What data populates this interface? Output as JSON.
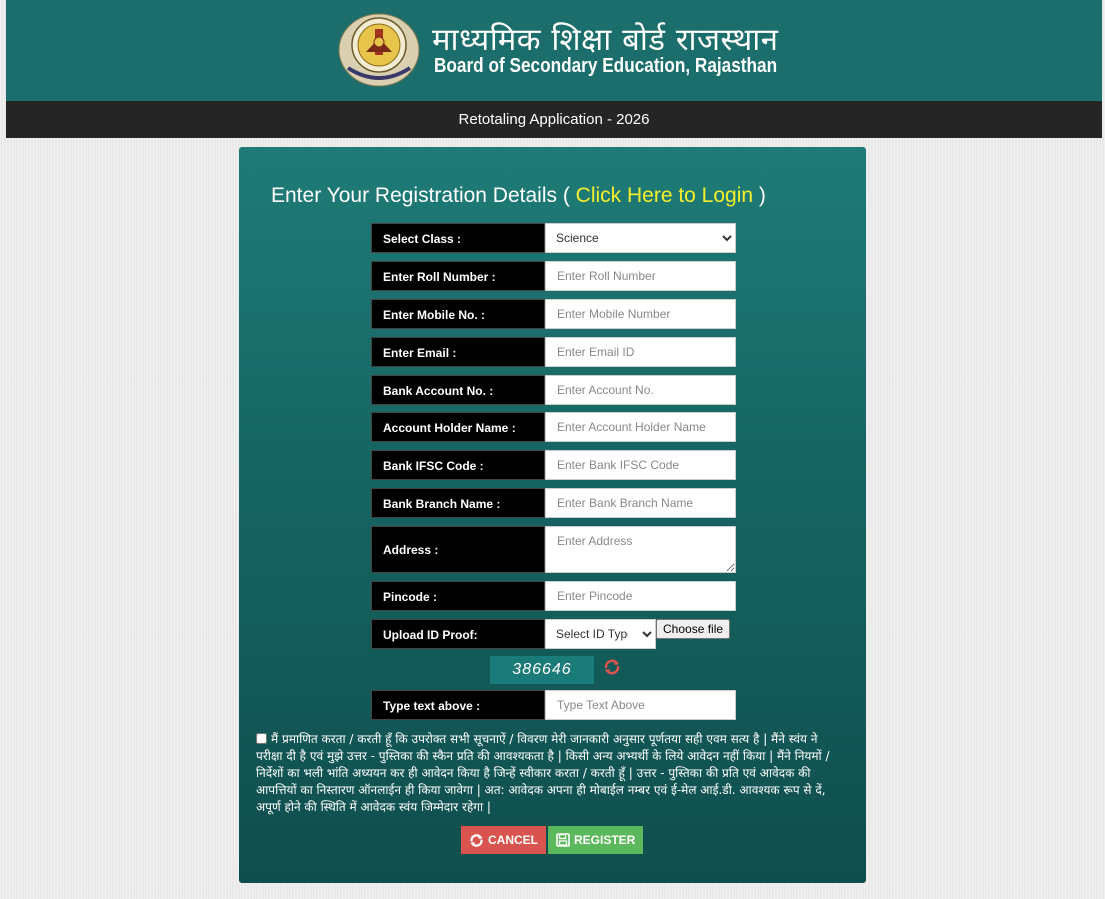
{
  "header": {
    "title_hindi": "माध्यमिक शिक्षा बोर्ड राजस्थान",
    "title_english": "Board of Secondary Education, Rajasthan",
    "logo_icon": "board-seal-emblem-icon"
  },
  "subbar": {
    "title": "Retotaling Application - 2026"
  },
  "form": {
    "heading_prefix": "Enter Your Registration Details ( ",
    "login_link": "Click Here to Login",
    "heading_suffix": " )",
    "fields": {
      "class_label": "Select Class :",
      "class_value": "Science",
      "roll_label": "Enter Roll Number :",
      "roll_placeholder": "Enter Roll Number",
      "mobile_label": "Enter Mobile No. :",
      "mobile_placeholder": "Enter Mobile Number",
      "email_label": "Enter Email :",
      "email_placeholder": "Enter Email ID",
      "account_label": "Bank Account No. :",
      "account_placeholder": "Enter Account No.",
      "holder_label": "Account Holder Name :",
      "holder_placeholder": "Enter Account Holder Name",
      "ifsc_label": "Bank IFSC Code :",
      "ifsc_placeholder": "Enter Bank IFSC Code",
      "branch_label": "Bank Branch Name :",
      "branch_placeholder": "Enter Bank Branch Name",
      "address_label": "Address :",
      "address_placeholder": "Enter Address",
      "pincode_label": "Pincode :",
      "pincode_placeholder": "Enter Pincode",
      "idproof_label": "Upload ID Proof:",
      "idproof_value": "Select ID Type",
      "choose_file": "Choose file",
      "captcha_text": "386646",
      "captcha_label": "Type text above :",
      "captcha_placeholder": "Type Text Above"
    },
    "declaration": "मैं प्रमाणित करता / करती हूँ कि उपरोक्त सभी सूचनाऐं / विवरण मेरी जानकारी अनुसार पूर्णतया सही एवम सत्य है | मैंने स्वंय ने परीक्षा दी है एवं मुझे उत्तर - पुस्तिका की स्कैन प्रति की आवश्यकता है | किसी अन्य अभ्यर्थी के लिये आवेदन नहीं किया | मैंने नियमों / निर्देशों का भली भांति अध्ययन कर ही आवेदन किया है जिन्हें स्वीकार करता / करती हूँ | उत्तर - पुस्तिका की प्रति एवं आवेदक की आपत्तियों का निस्तारण ऑनलाईन ही किया जावेगा | अत: आवेदक अपना ही मोबाईल नम्बर एवं ई-मेल आई.डी. आवश्यक रूप से दें, अपूर्ण होने की स्थिति में आवेदक स्वंय जिम्मेदार रहेगा |",
    "buttons": {
      "cancel": "CANCEL",
      "register": "REGISTER"
    },
    "colors": {
      "panel": "#166764",
      "link": "#f4ef2a",
      "cancel": "#d9534f",
      "register": "#5cb85c"
    }
  }
}
